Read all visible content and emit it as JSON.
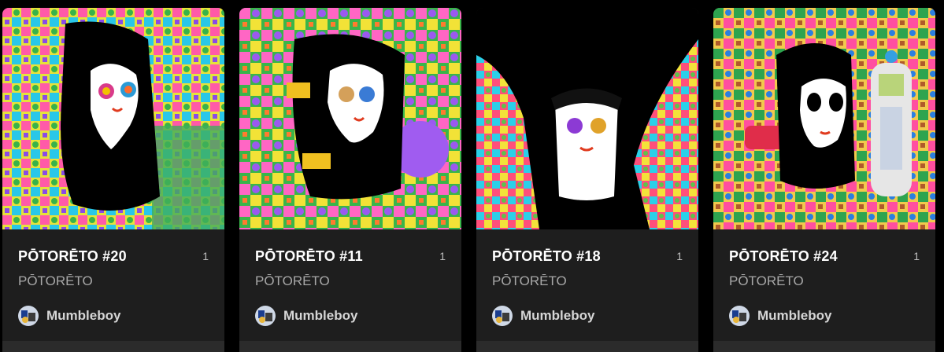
{
  "cards": [
    {
      "title": "PŌTORĒTO #20",
      "count": "1",
      "collection": "PŌTORĒTO",
      "creator": "Mumbleboy",
      "art_icon": "portrait-artwork"
    },
    {
      "title": "PŌTORĒTO #11",
      "count": "1",
      "collection": "PŌTORĒTO",
      "creator": "Mumbleboy",
      "art_icon": "portrait-artwork"
    },
    {
      "title": "PŌTORĒTO #18",
      "count": "1",
      "collection": "PŌTORĒTO",
      "creator": "Mumbleboy",
      "art_icon": "portrait-artwork"
    },
    {
      "title": "PŌTORĒTO #24",
      "count": "1",
      "collection": "PŌTORĒTO",
      "creator": "Mumbleboy",
      "art_icon": "portrait-artwork"
    }
  ],
  "colors": {
    "page_bg": "#000000",
    "card_bg": "#1e1e1e",
    "title": "#ffffff",
    "muted": "#a8a8a8"
  }
}
